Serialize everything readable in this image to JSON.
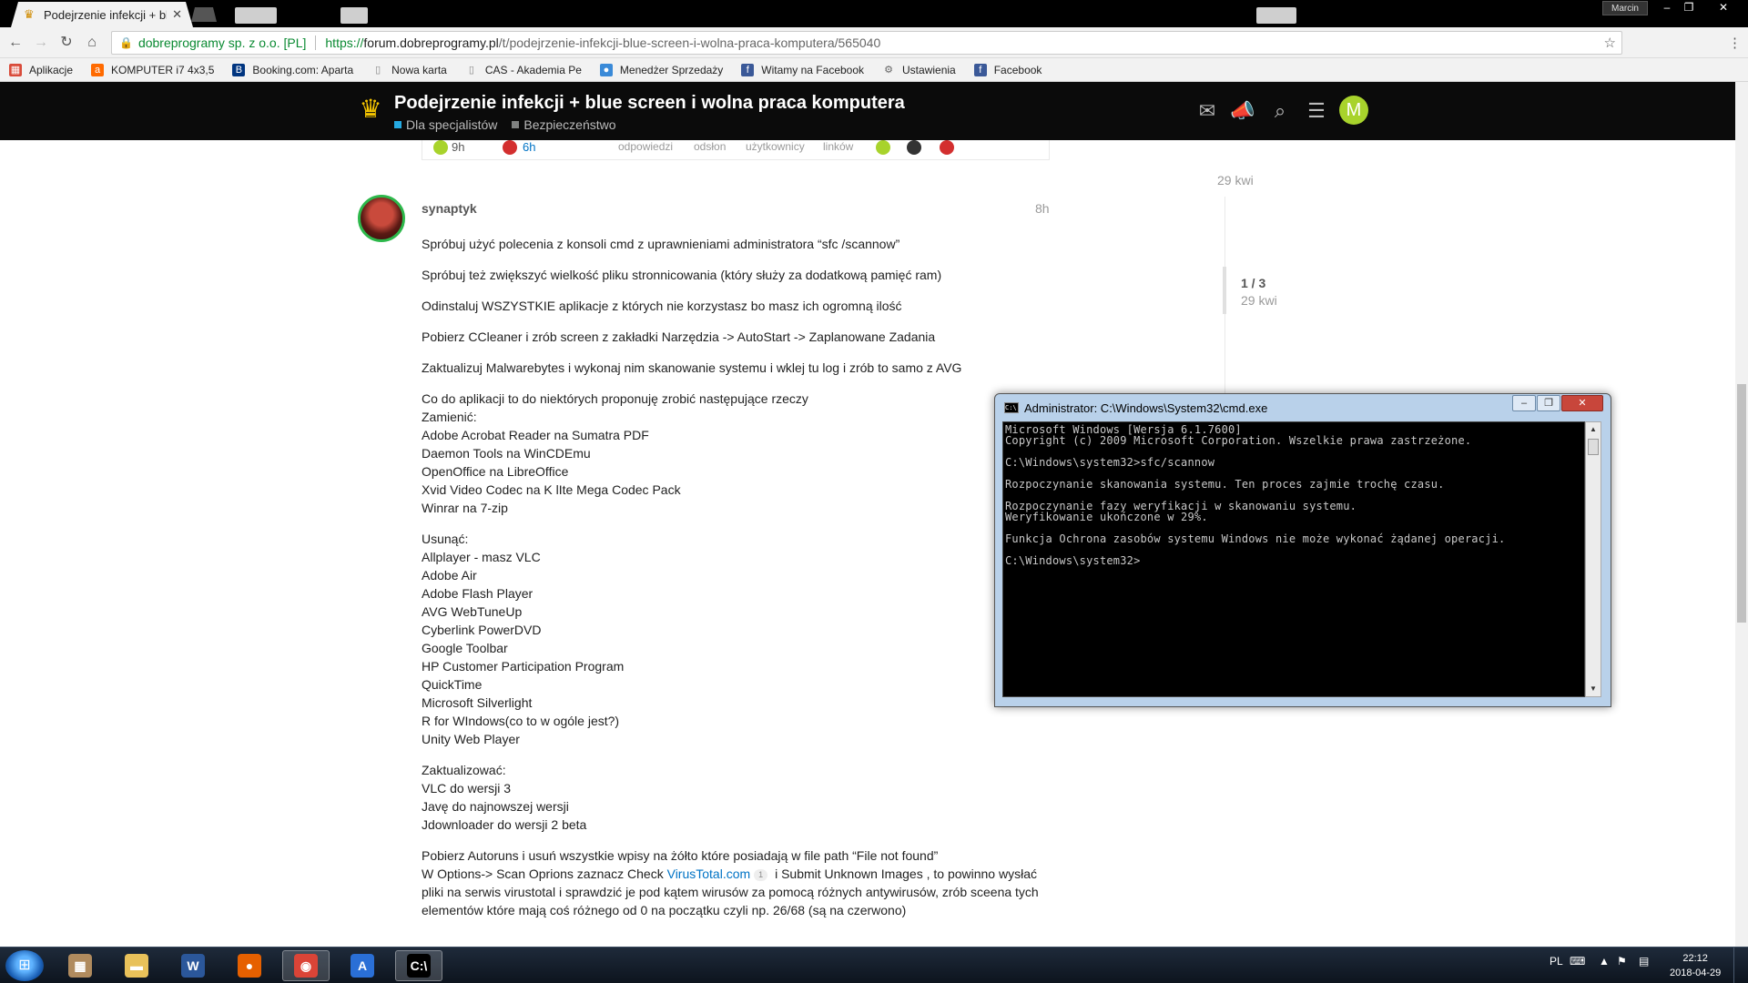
{
  "browser": {
    "tab_title": "Podejrzenie infekcji + blu",
    "user_name": "Marcin",
    "site_identity": "dobreprogramy sp. z o.o. [PL]",
    "url_scheme": "https://",
    "url_host": "forum.dobreprogramy.pl",
    "url_path": "/t/podejrzenie-infekcji-blue-screen-i-wolna-praca-komputera/565040"
  },
  "bookmarks": [
    {
      "label": "Aplikacje",
      "icon": "apps-icon",
      "color": "#d94b3a"
    },
    {
      "label": "KOMPUTER i7 4x3,5",
      "icon": "amazon-icon",
      "color": "#ff6a00"
    },
    {
      "label": "Booking.com: Aparta",
      "icon": "booking-icon",
      "color": "#003580"
    },
    {
      "label": "Nowa karta",
      "icon": "page-icon",
      "color": "#888888"
    },
    {
      "label": "CAS - Akademia Pe",
      "icon": "page-icon",
      "color": "#888888"
    },
    {
      "label": "Menedżer Sprzedaży",
      "icon": "messenger-icon",
      "color": "#3a8ad8"
    },
    {
      "label": "Witamy na Facebook",
      "icon": "facebook-icon",
      "color": "#3b5998"
    },
    {
      "label": "Ustawienia",
      "icon": "gear-icon",
      "color": "#666666"
    },
    {
      "label": "Facebook",
      "icon": "facebook-icon",
      "color": "#3b5998"
    }
  ],
  "forum": {
    "topic_title": "Podejrzenie infekcji + blue screen i wolna praca komputera",
    "category": "Dla specjalistów",
    "category_color": "#25AAE2",
    "subcategory": "Bezpieczeństwo",
    "subcategory_color": "#808281",
    "user_avatar_letter": "M",
    "summary": {
      "created": "9h",
      "last_reply": "6h",
      "replies_label": "odpowiedzi",
      "views_label": "odsłon",
      "users_label": "użytkownicy",
      "links_label": "linków"
    }
  },
  "post": {
    "author": "synaptyk",
    "time": "8h",
    "paragraphs": [
      [
        "Spróbuj użyć polecenia z konsoli cmd z uprawnieniami administratora “sfc /scannow”"
      ],
      [
        "Spróbuj też zwiększyć wielkość pliku stronnicowania (który służy za dodatkową pamięć ram)"
      ],
      [
        "Odinstaluj WSZYSTKIE aplikacje z których nie korzystasz bo masz ich ogromną ilość"
      ],
      [
        "Pobierz CCleaner i zrób screen z zakładki Narzędzia -> AutoStart -> Zaplanowane Zadania"
      ],
      [
        "Zaktualizuj Malwarebytes i wykonaj nim skanowanie systemu i wklej tu log i zrób to samo z AVG"
      ],
      [
        "Co do aplikacji to do niektórych proponuję zrobić następujące rzeczy",
        "Zamienić:",
        "Adobe Acrobat Reader na Sumatra PDF",
        "Daemon Tools na WinCDEmu",
        "OpenOffice na LibreOffice",
        "Xvid Video Codec na K lIte Mega Codec Pack",
        "Winrar na 7-zip"
      ],
      [
        "Usunąć:",
        "Allplayer - masz VLC",
        "Adobe Air",
        "Adobe Flash Player",
        "AVG WebTuneUp",
        "Cyberlink PowerDVD",
        "Google Toolbar",
        "HP Customer Participation Program",
        "QuickTime",
        "Microsoft Silverlight",
        "R for WIndows(co to w ogóle jest?)",
        "Unity Web Player"
      ],
      [
        "Zaktualizować:",
        "VLC do wersji 3",
        "Javę do najnowszej wersji",
        "Jdownloader do wersji 2 beta"
      ]
    ],
    "last_paragraph": {
      "line1": "Pobierz Autoruns i usuń wszystkie wpisy na żółto które posiadają w file path “File not found”",
      "line2_before": "W Options-> Scan Oprions zaznacz Check ",
      "link": "VirusTotal.com",
      "link_badge": "1",
      "line2_after": " i Submit Unknown Images , to powinno wysłać",
      "line3": "pliki na serwis virustotal i sprawdzić je pod kątem wirusów za pomocą różnych antywirusów, zrób sceena tych",
      "line4": "elementów które mają coś różnego od 0 na początku czyli np. 26/68 (są na czerwono)"
    }
  },
  "timeline": {
    "date_top": "29 kwi",
    "position": "1 / 3",
    "date": "29 kwi"
  },
  "cmd": {
    "title": "Administrator: C:\\Windows\\System32\\cmd.exe",
    "output": "Microsoft Windows [Wersja 6.1.7600]\nCopyright (c) 2009 Microsoft Corporation. Wszelkie prawa zastrzeżone.\n\nC:\\Windows\\system32>sfc/scannow\n\nRozpoczynanie skanowania systemu. Ten proces zajmie trochę czasu.\n\nRozpoczynanie fazy weryfikacji w skanowaniu systemu.\nWeryfikowanie ukończone w 29%.\n\nFunkcja Ochrona zasobów systemu Windows nie może wykonać żądanej operacji.\n\nC:\\Windows\\system32>"
  },
  "taskbar": {
    "apps": [
      {
        "name": "taskbar-app-archive",
        "icon": "archive-icon",
        "glyph": "▦",
        "color": "#b08b5e"
      },
      {
        "name": "taskbar-app-explorer",
        "icon": "folder-icon",
        "glyph": "▬",
        "color": "#e8c15a"
      },
      {
        "name": "taskbar-app-word",
        "icon": "word-icon",
        "glyph": "W",
        "color": "#2b579a"
      },
      {
        "name": "taskbar-app-firefox",
        "icon": "firefox-icon",
        "glyph": "●",
        "color": "#e66000"
      },
      {
        "name": "taskbar-app-chrome",
        "icon": "chrome-icon",
        "glyph": "◉",
        "color": "#db4437"
      },
      {
        "name": "taskbar-app-autocad",
        "icon": "autocad-icon",
        "glyph": "A",
        "color": "#2a6fd6"
      },
      {
        "name": "taskbar-app-cmd",
        "icon": "cmd-icon",
        "glyph": "C:\\",
        "color": "#000000"
      }
    ],
    "language": "PL",
    "time": "22:12",
    "date": "2018-04-29"
  }
}
